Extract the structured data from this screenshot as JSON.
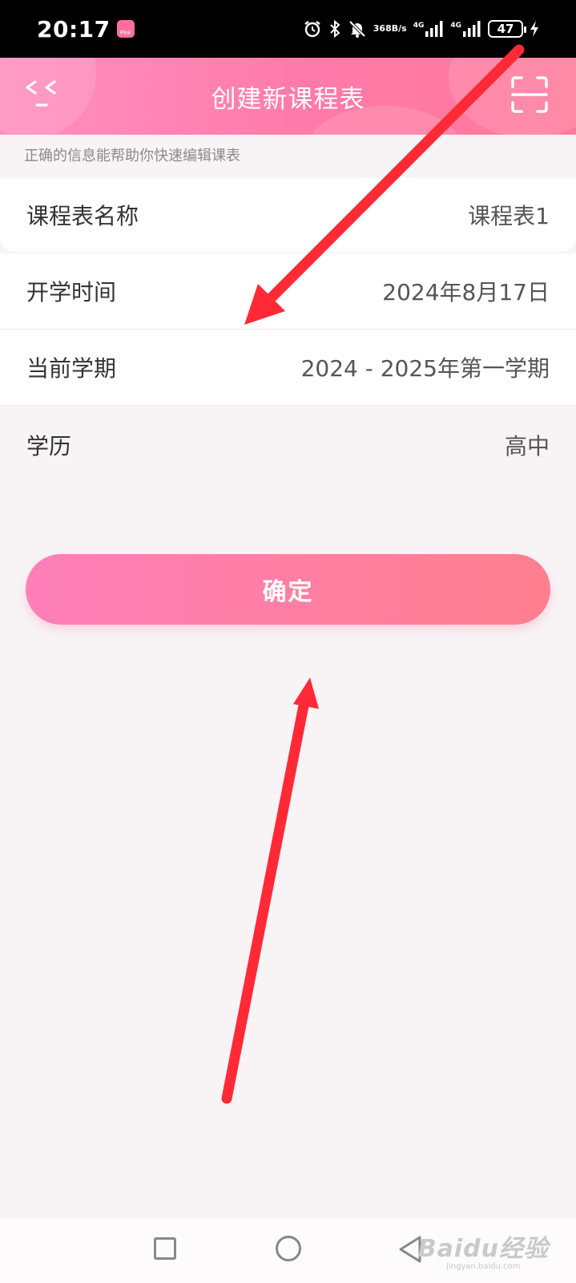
{
  "status_bar": {
    "time": "20:17",
    "app_badge": "Pink",
    "net_speed_top": "368",
    "net_speed_bottom": "B/s",
    "signal1_tag": "4G",
    "signal2_tag": "4G",
    "battery": "47"
  },
  "header": {
    "title": "创建新课程表",
    "back_icon": "back-chevrons-icon",
    "scan_icon": "scan-icon"
  },
  "hint": "正确的信息能帮助你快速编辑课表",
  "form": {
    "rows": [
      {
        "label": "课程表名称",
        "value": "课程表1"
      },
      {
        "label": "开学时间",
        "value": "2024年8月17日"
      },
      {
        "label": "当前学期",
        "value": "2024 - 2025年第一学期"
      },
      {
        "label": "学历",
        "value": "高中"
      }
    ]
  },
  "confirm_label": "确定",
  "colors": {
    "accent_start": "#ff7fb9",
    "accent_end": "#ff7f8f",
    "annotation_arrow": "#ff2a35"
  },
  "watermark": {
    "main": "Baidu经验",
    "sub": "jingyan.baidu.com"
  }
}
